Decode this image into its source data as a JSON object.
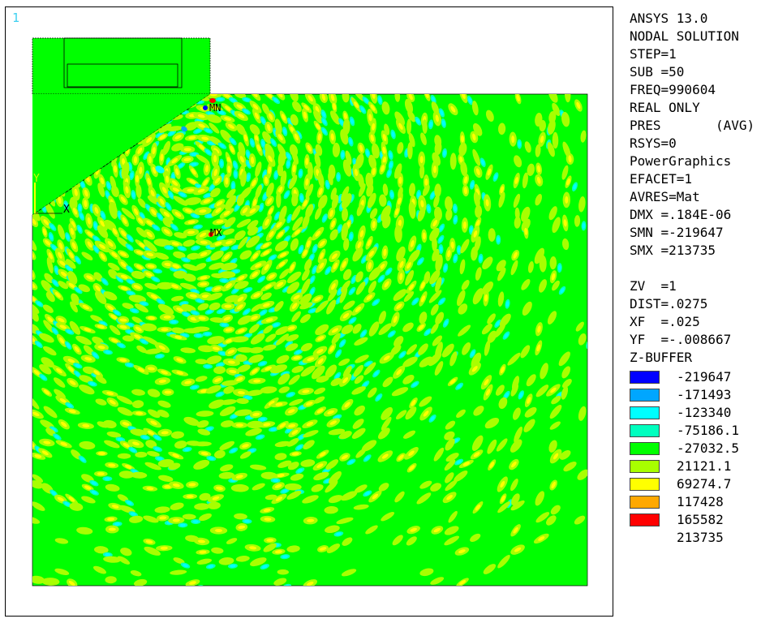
{
  "window_number": "1",
  "markers": {
    "min": "MN",
    "max": "MX",
    "axis_x": "X",
    "axis_y": "Y"
  },
  "info": {
    "lines": [
      "ANSYS 13.0",
      "NODAL SOLUTION",
      "STEP=1",
      "SUB =50",
      "FREQ=990604",
      "REAL ONLY",
      "PRES       (AVG)",
      "RSYS=0",
      "PowerGraphics",
      "EFACET=1",
      "AVRES=Mat",
      "DMX =.184E-06",
      "SMN =-219647",
      "SMX =213735"
    ],
    "view_lines": [
      "ZV  =1",
      "DIST=.0275",
      "XF  =.025",
      "YF  =-.008667",
      "Z-BUFFER"
    ]
  },
  "legend": {
    "entries": [
      {
        "color": "#0000ff",
        "label": "-219647"
      },
      {
        "color": "#00a6ff",
        "label": "-171493"
      },
      {
        "color": "#00ffff",
        "label": "-123340"
      },
      {
        "color": "#00ffbf",
        "label": "-75186.1"
      },
      {
        "color": "#00ff00",
        "label": "-27032.5"
      },
      {
        "color": "#a8ff00",
        "label": "21121.1"
      },
      {
        "color": "#ffff00",
        "label": "69274.7"
      },
      {
        "color": "#ffa800",
        "label": "117428"
      },
      {
        "color": "#ff0000",
        "label": "165582"
      },
      {
        "color": "",
        "label": "213735"
      }
    ]
  },
  "colors": {
    "background_field": "#00ff00",
    "band_positive": "#ffff00",
    "band_mid": "#a8ff00",
    "band_negative": "#00ffff",
    "band_negative2": "#00ffbf"
  }
}
